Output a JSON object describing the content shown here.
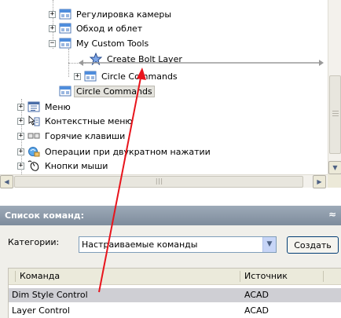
{
  "tree": {
    "items": [
      {
        "label": "Регулировка камеры",
        "expander": "+",
        "icon": "toolbar-icon"
      },
      {
        "label": "Обход и облет",
        "expander": "+",
        "icon": "toolbar-icon"
      },
      {
        "label": "My Custom Tools",
        "expander": "−",
        "icon": "toolbar-icon"
      },
      {
        "label": "Create Bolt Layer",
        "expander": "",
        "icon": "star-icon"
      },
      {
        "label": "Circle Commands",
        "expander": "+",
        "icon": "toolbar-icon"
      },
      {
        "label": "Circle Commands",
        "expander": "",
        "icon": "toolbar-icon"
      },
      {
        "label": "Меню",
        "expander": "+",
        "icon": "menu-icon"
      },
      {
        "label": "Контекстные меню",
        "expander": "+",
        "icon": "context-menu-icon"
      },
      {
        "label": "Горячие клавиши",
        "expander": "+",
        "icon": "keyboard-icon"
      },
      {
        "label": "Операции при двукратном нажатии",
        "expander": "+",
        "icon": "double-click-icon"
      },
      {
        "label": "Кнопки мыши",
        "expander": "+",
        "icon": "mouse-icon"
      }
    ]
  },
  "command_list": {
    "title": "Список команд:",
    "categories_label": "Категории:",
    "category_value": "Настраиваемые команды",
    "create_button": "Создать",
    "columns": [
      "Команда",
      "Источник"
    ],
    "rows": [
      {
        "command": "Dim Style Control",
        "source": "ACAD"
      },
      {
        "command": "Layer Control",
        "source": "ACAD"
      }
    ]
  },
  "colors": {
    "annotation_arrow": "#e8141c",
    "header_bg": "#8a97a7"
  }
}
